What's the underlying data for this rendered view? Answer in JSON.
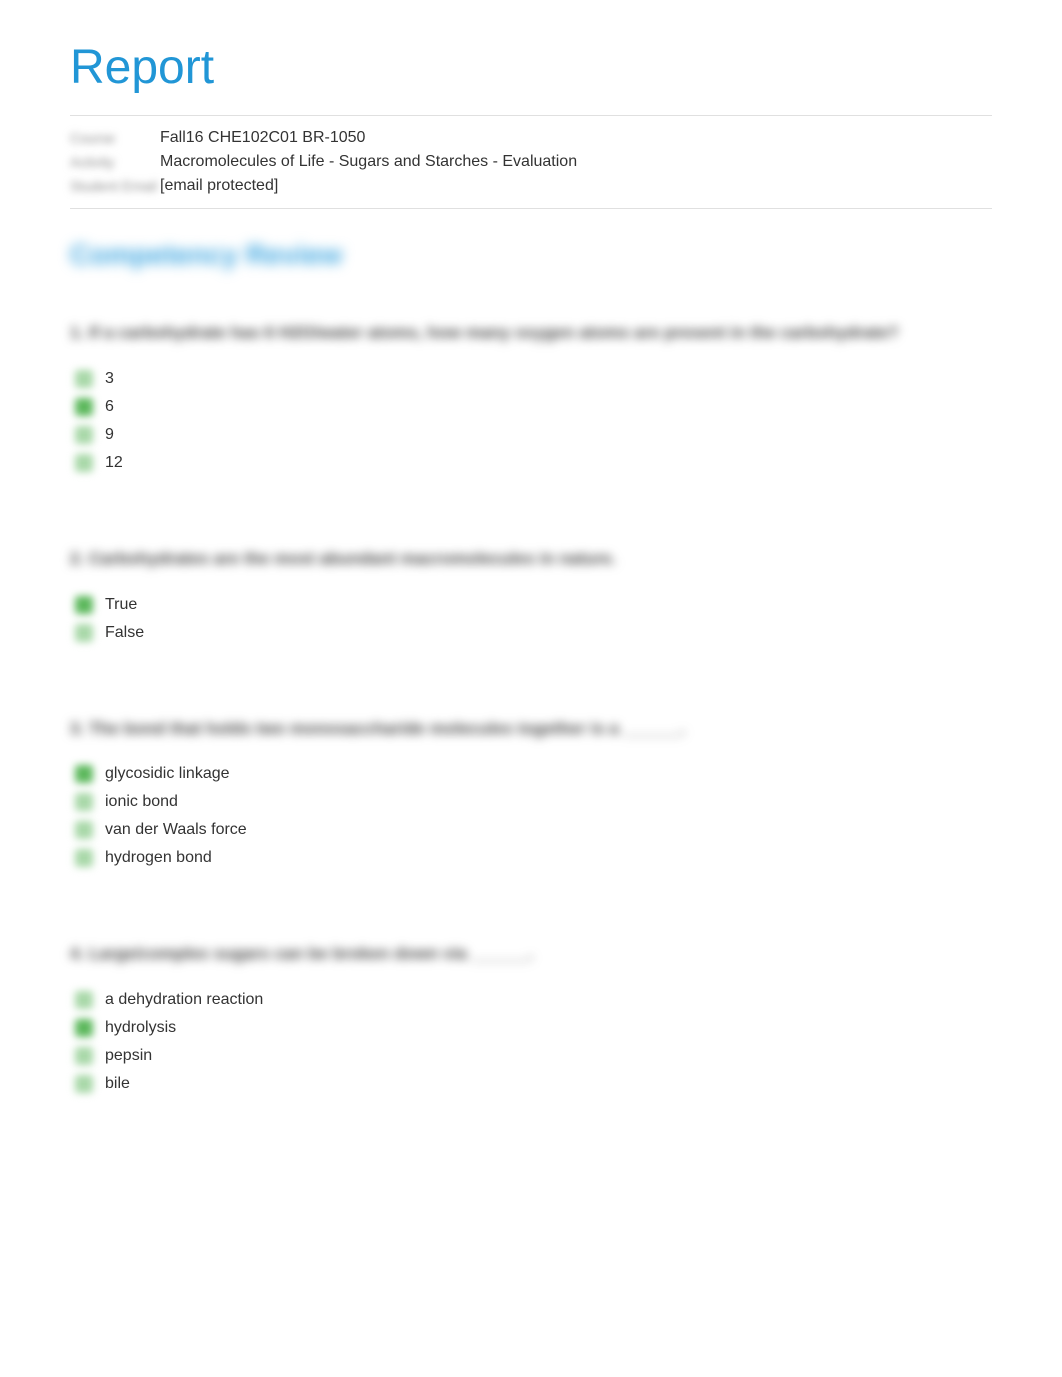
{
  "title": "Report",
  "meta": {
    "label1": "Course",
    "value1": "Fall16 CHE102C01 BR-1050",
    "label2": "Activity",
    "value2": "Macromolecules of Life - Sugars and Starches - Evaluation",
    "label3": "Student Email",
    "value3": "[email protected]"
  },
  "section_header": "Competency Review",
  "questions": [
    {
      "prompt": "1. If a carbohydrate has 6 H2O/water atoms, how many oxygen atoms are present in the carbohydrate?",
      "options": [
        {
          "text": "3",
          "state": "unchecked"
        },
        {
          "text": "6",
          "state": "correct"
        },
        {
          "text": "9",
          "state": "unchecked"
        },
        {
          "text": "12",
          "state": "unchecked"
        }
      ]
    },
    {
      "prompt": "2. Carbohydrates are the most abundant macromolecules in nature.",
      "options": [
        {
          "text": "True",
          "state": "correct"
        },
        {
          "text": "False",
          "state": "unchecked"
        }
      ]
    },
    {
      "prompt": "3. The bond that holds two monosaccharide molecules together is a ______.",
      "options": [
        {
          "text": "glycosidic linkage",
          "state": "correct"
        },
        {
          "text": "ionic bond",
          "state": "unchecked"
        },
        {
          "text": "van der Waals force",
          "state": "unchecked"
        },
        {
          "text": "hydrogen bond",
          "state": "unchecked"
        }
      ]
    },
    {
      "prompt": "4. Large/complex sugars can be broken down via ______.",
      "options": [
        {
          "text": "a dehydration reaction",
          "state": "unchecked"
        },
        {
          "text": "hydrolysis",
          "state": "correct"
        },
        {
          "text": "pepsin",
          "state": "unchecked"
        },
        {
          "text": "bile",
          "state": "unchecked"
        }
      ]
    }
  ]
}
